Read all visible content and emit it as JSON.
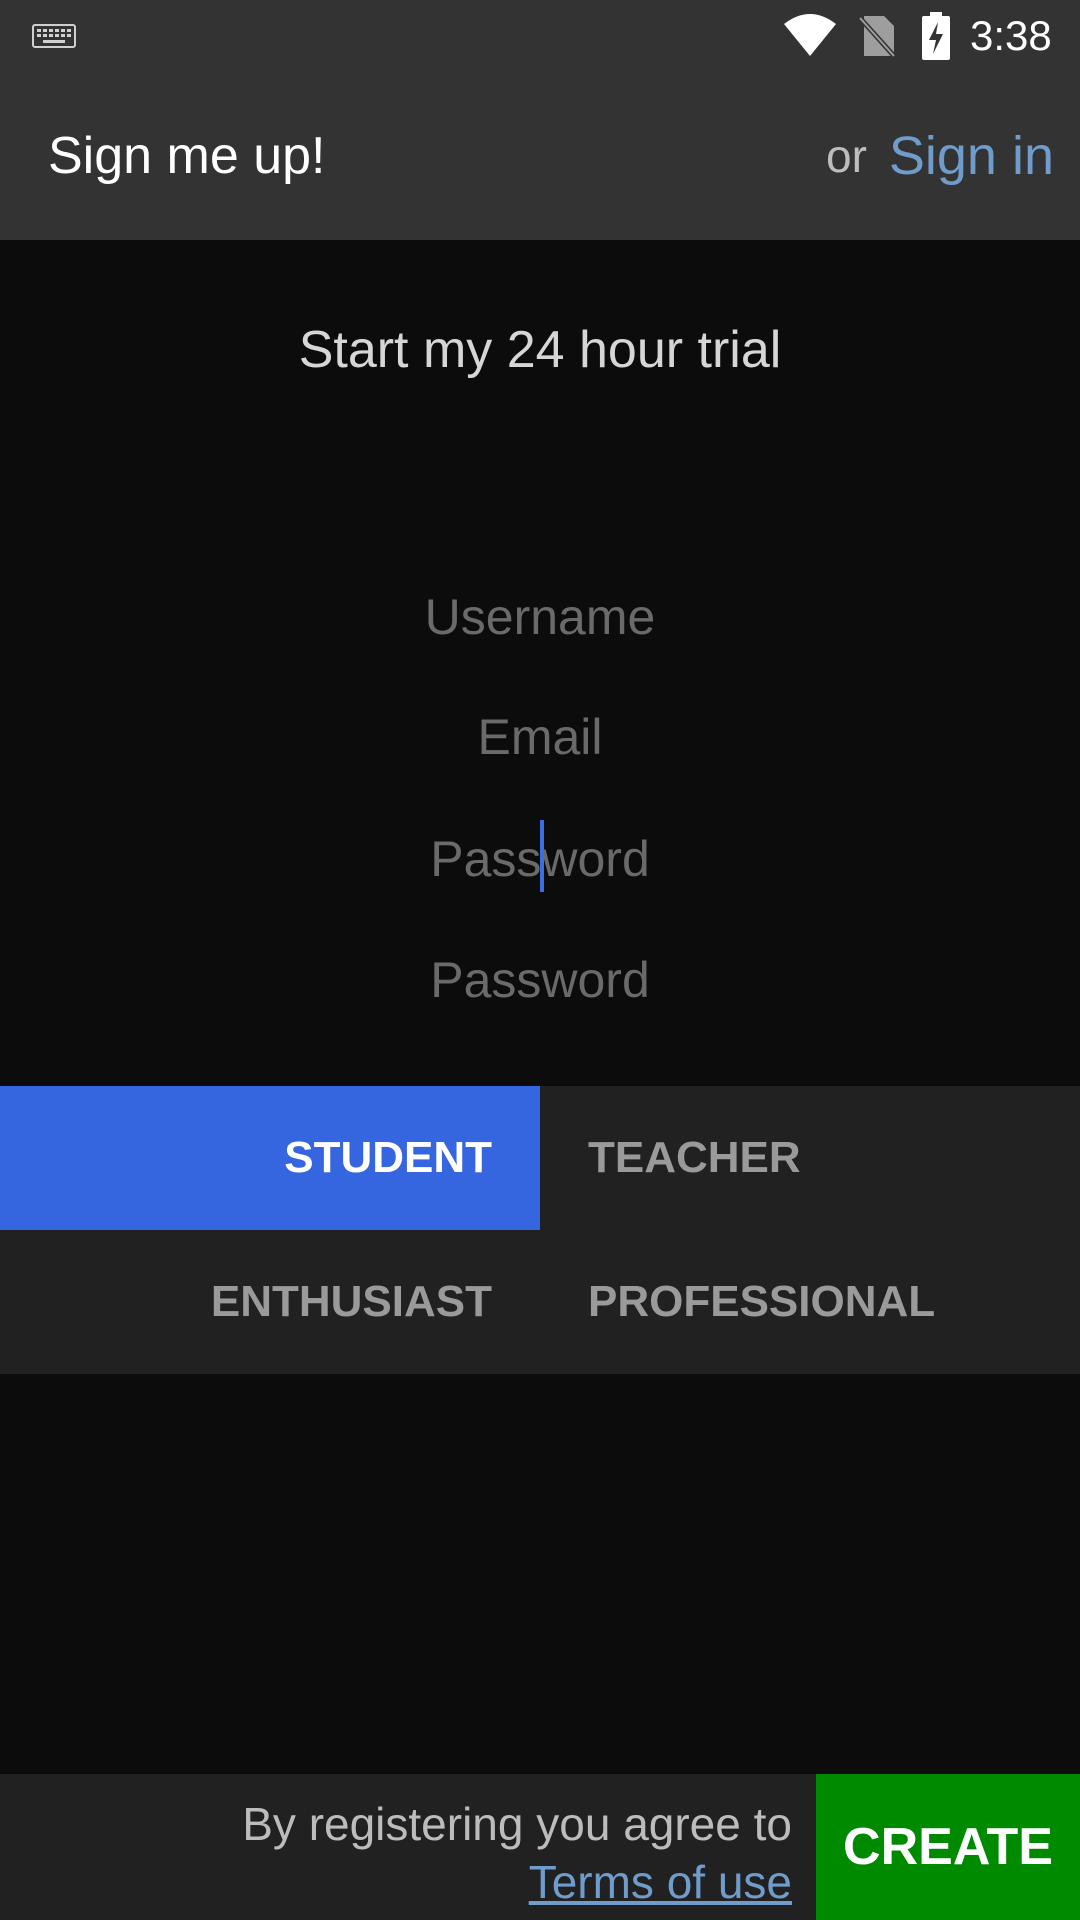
{
  "status_bar": {
    "time": "3:38",
    "icons": [
      "keyboard-icon",
      "wifi-icon",
      "no-sim-icon",
      "battery-charging-icon"
    ]
  },
  "app_bar": {
    "title": "Sign me up!",
    "or_text": "or",
    "sign_in_label": "Sign in"
  },
  "form": {
    "heading": "Start my 24 hour trial",
    "username_placeholder": "Username",
    "email_placeholder": "Email",
    "password_placeholder": "Password",
    "confirm_password_placeholder": "Password"
  },
  "roles": {
    "options": [
      {
        "label": "STUDENT",
        "selected": true
      },
      {
        "label": "TEACHER",
        "selected": false
      },
      {
        "label": "ENTHUSIAST",
        "selected": false
      },
      {
        "label": "PROFESSIONAL",
        "selected": false
      }
    ]
  },
  "footer": {
    "agree_text": "By registering you agree to",
    "terms_label": "Terms of use",
    "create_label": "CREATE"
  },
  "colors": {
    "accent_blue": "#3565df",
    "link_blue": "#6f9ccb",
    "create_green": "#008a00"
  }
}
